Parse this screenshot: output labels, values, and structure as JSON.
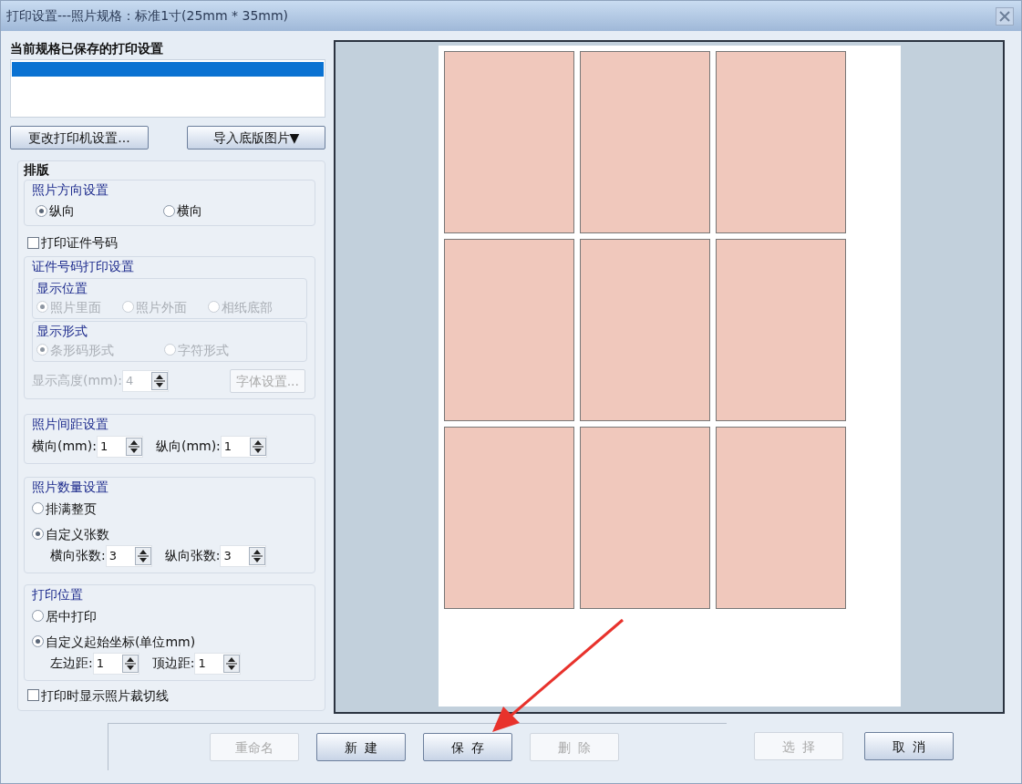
{
  "window": {
    "title": "打印设置---照片规格：标准1寸(25mm * 35mm)"
  },
  "saved_settings": {
    "title": "当前规格已保存的打印设置",
    "items": [
      {
        "selected": true
      }
    ]
  },
  "top_buttons": [
    "更改打印机设置...",
    "导入底版图片▼"
  ],
  "layout": {
    "title": "排版",
    "orientation": {
      "legend": "照片方向设置",
      "options": [
        {
          "label": "纵向",
          "selected": true
        },
        {
          "label": "横向",
          "selected": false
        }
      ]
    },
    "print_id": {
      "label": "打印证件号码",
      "checked": false
    },
    "id_settings": {
      "legend": "证件号码打印设置",
      "disabled": true,
      "position": {
        "legend": "显示位置",
        "options": [
          {
            "label": "照片里面",
            "selected": true
          },
          {
            "label": "照片外面",
            "selected": false
          },
          {
            "label": "相纸底部",
            "selected": false
          }
        ]
      },
      "form": {
        "legend": "显示形式",
        "options": [
          {
            "label": "条形码形式",
            "selected": true
          },
          {
            "label": "字符形式",
            "selected": false
          }
        ]
      },
      "height": {
        "label": "显示高度(mm):",
        "value": "4"
      },
      "font_button": "字体设置..."
    },
    "spacing": {
      "legend": "照片间距设置",
      "fields": [
        {
          "label": "横向(mm):",
          "value": "1"
        },
        {
          "label": "纵向(mm):",
          "value": "1"
        }
      ]
    },
    "count": {
      "legend": "照片数量设置",
      "options": [
        {
          "label": "排满整页",
          "selected": false
        },
        {
          "label": "自定义张数",
          "selected": true
        }
      ],
      "fields": [
        {
          "label": "横向张数:",
          "value": "3"
        },
        {
          "label": "纵向张数:",
          "value": "3"
        }
      ]
    },
    "position": {
      "legend": "打印位置",
      "options": [
        {
          "label": "居中打印",
          "selected": false
        },
        {
          "label": "自定义起始坐标(单位mm)",
          "selected": true
        }
      ],
      "fields": [
        {
          "label": "左边距:",
          "value": "1"
        },
        {
          "label": "顶边距:",
          "value": "1"
        }
      ]
    },
    "cutline": {
      "label": "打印时显示照片裁切线",
      "checked": false
    }
  },
  "bottom_buttons": [
    {
      "label": "重命名",
      "disabled": true
    },
    {
      "label": "新  建",
      "disabled": false
    },
    {
      "label": "保  存",
      "disabled": false
    },
    {
      "label": "删  除",
      "disabled": true
    }
  ],
  "dialog_buttons": [
    {
      "label": "选  择",
      "disabled": true
    },
    {
      "label": "取  消",
      "disabled": false
    }
  ]
}
